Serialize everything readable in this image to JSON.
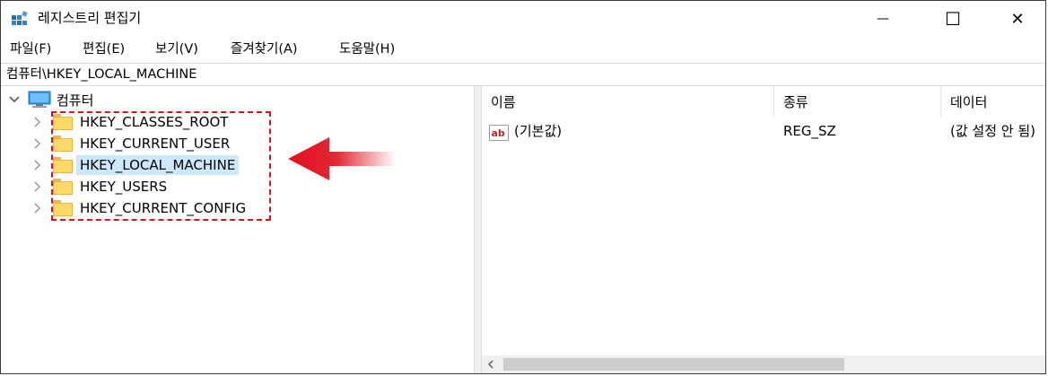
{
  "window": {
    "title": "레지스트리 편집기",
    "minimize_glyph": "—",
    "maximize_glyph": "☐",
    "close_glyph": "✕"
  },
  "menu": [
    "파일(F)",
    "편집(E)",
    "보기(V)",
    "즐겨찾기(A)",
    "도움말(H)"
  ],
  "address": "컴퓨터\\HKEY_LOCAL_MACHINE",
  "tree": {
    "root": "컴퓨터",
    "root_icon": "computer-icon",
    "folder_icon": "folder-icon",
    "items": [
      {
        "label": "HKEY_CLASSES_ROOT",
        "selected": false
      },
      {
        "label": "HKEY_CURRENT_USER",
        "selected": false
      },
      {
        "label": "HKEY_LOCAL_MACHINE",
        "selected": true
      },
      {
        "label": "HKEY_USERS",
        "selected": false
      },
      {
        "label": "HKEY_CURRENT_CONFIG",
        "selected": false
      }
    ]
  },
  "list": {
    "columns": [
      "이름",
      "종류",
      "데이터"
    ],
    "rows": [
      {
        "name": "(기본값)",
        "type": "REG_SZ",
        "data": "(값 설정 안 됨)",
        "icon": "string-value-icon"
      }
    ]
  },
  "annotation": {
    "highlight_color": "#e0101d",
    "arrow_color": "#e0101d"
  },
  "colors": {
    "selection": "#cce8ff"
  }
}
